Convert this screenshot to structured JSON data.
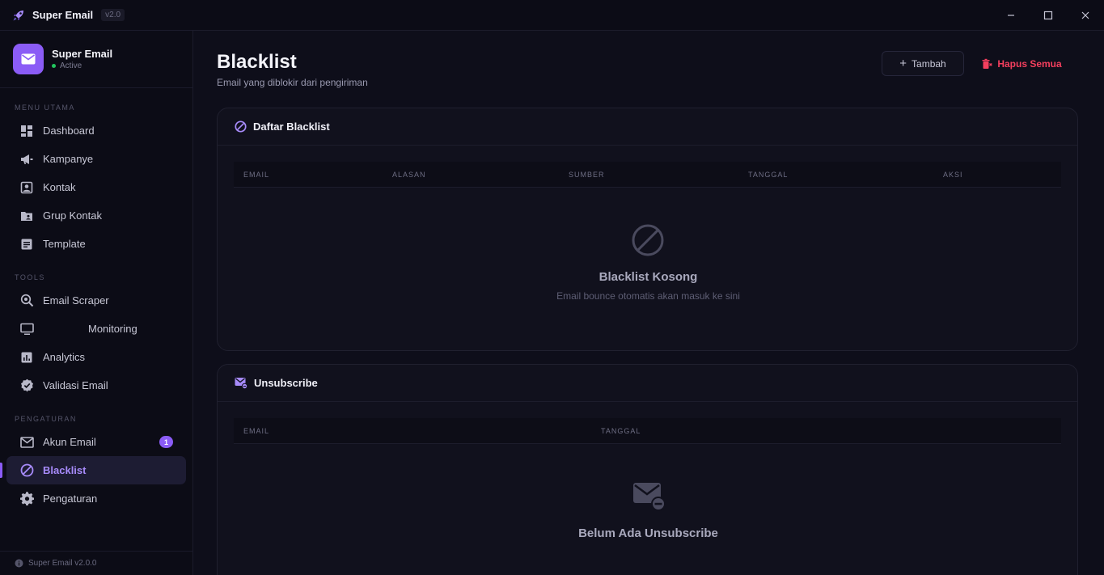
{
  "app": {
    "title": "Super Email",
    "version": "v2.0"
  },
  "brand": {
    "name": "Super Email",
    "status": "Active"
  },
  "sidebar": {
    "sections": [
      "MENU UTAMA",
      "TOOLS",
      "PENGATURAN"
    ],
    "items": [
      {
        "label": "Dashboard"
      },
      {
        "label": "Kampanye"
      },
      {
        "label": "Kontak"
      },
      {
        "label": "Grup Kontak"
      },
      {
        "label": "Template"
      },
      {
        "label": "Email Scraper"
      },
      {
        "label": "Monitoring"
      },
      {
        "label": "Analytics"
      },
      {
        "label": "Validasi Email"
      },
      {
        "label": "Akun Email",
        "badge": "1"
      },
      {
        "label": "Blacklist"
      },
      {
        "label": "Pengaturan"
      }
    ],
    "footer": "Super Email v2.0.0"
  },
  "page": {
    "title": "Blacklist",
    "subtitle": "Email yang diblokir dari pengiriman",
    "add_label": "Tambah",
    "delete_all_label": "Hapus Semua"
  },
  "blacklist_card": {
    "title": "Daftar Blacklist",
    "columns": [
      "EMAIL",
      "ALASAN",
      "SUMBER",
      "TANGGAL",
      "AKSI"
    ],
    "empty_title": "Blacklist Kosong",
    "empty_sub": "Email bounce otomatis akan masuk ke sini"
  },
  "unsub_card": {
    "title": "Unsubscribe",
    "columns": [
      "EMAIL",
      "TANGGAL"
    ],
    "empty_title": "Belum Ada Unsubscribe"
  },
  "colors": {
    "accent": "#8b5cf6",
    "danger": "#f43f5e",
    "success": "#22c55e"
  }
}
